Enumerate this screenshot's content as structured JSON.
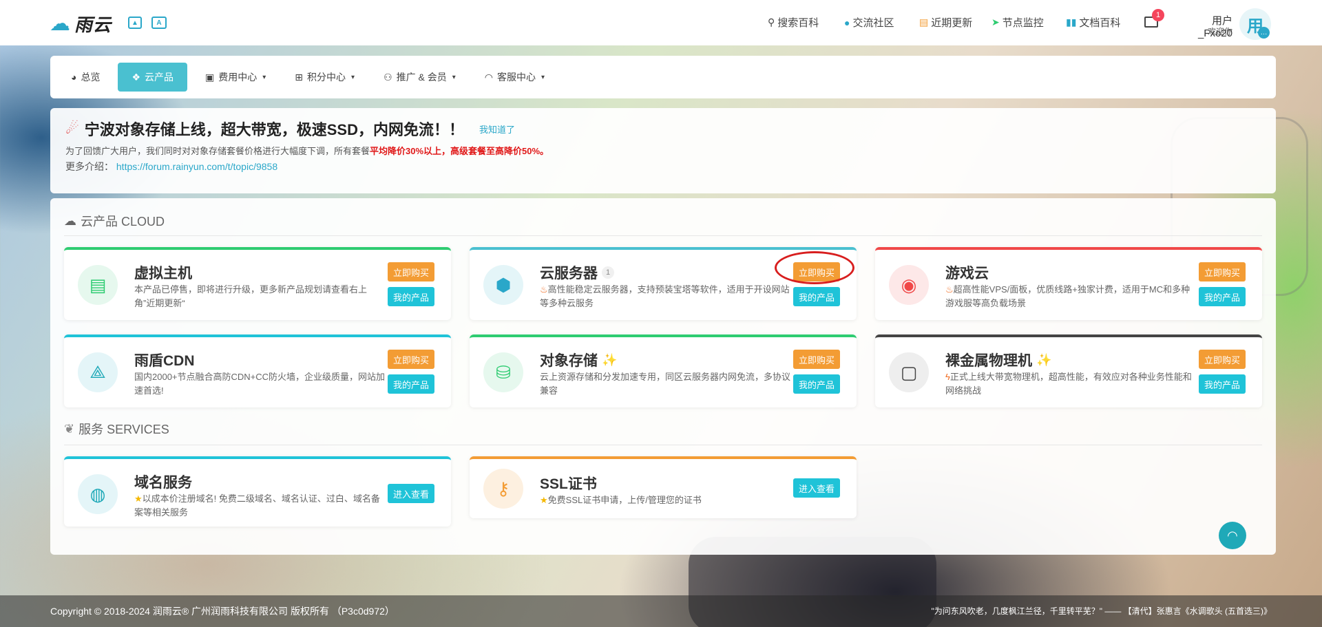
{
  "header": {
    "logo_text": "雨云",
    "icon1": "image-icon",
    "icon2": "translate-icon",
    "nav": [
      {
        "label": "搜索百科",
        "icon": "search-icon"
      },
      {
        "label": "交流社区",
        "icon": "chat-icon"
      },
      {
        "label": "近期更新",
        "icon": "list-icon"
      },
      {
        "label": "节点监控",
        "icon": "send-icon"
      },
      {
        "label": "文档百科",
        "icon": "book-icon"
      }
    ],
    "mail_badge": "1",
    "user_name": "用户_Fxo20",
    "user_welcome": "欢迎你",
    "avatar_text": "用"
  },
  "mainnav": [
    {
      "label": "总览",
      "icon": "dashboard-icon",
      "active": false,
      "dropdown": false
    },
    {
      "label": "云产品",
      "icon": "cloud-cubes-icon",
      "active": true,
      "dropdown": false
    },
    {
      "label": "费用中心",
      "icon": "money-icon",
      "active": false,
      "dropdown": true
    },
    {
      "label": "积分中心",
      "icon": "gift-icon",
      "active": false,
      "dropdown": true
    },
    {
      "label": "推广 & 会员",
      "icon": "users-icon",
      "active": false,
      "dropdown": true
    },
    {
      "label": "客服中心",
      "icon": "headset-icon",
      "active": false,
      "dropdown": true
    }
  ],
  "notice": {
    "title": "宁波对象存储上线，超大带宽，极速SSD，内网免流！！",
    "dismiss": "我知道了",
    "line_prefix": "为了回馈广大用户，我们同时对对象存储套餐价格进行大幅度下调，所有套餐",
    "line_highlight": "平均降价30%以上，高级套餐至高降价50%。",
    "more_label": "更多介绍：",
    "more_link": "https://forum.rainyun.com/t/topic/9858"
  },
  "cloud_section": {
    "title": "云产品 CLOUD",
    "cards": [
      {
        "name": "虚拟主机",
        "desc": "本产品已停售，即将进行升级，更多新产品规划请查看右上角”近期更新“",
        "buy": "立即购买",
        "my": "我的产品",
        "color": "#2ecc71",
        "icon": "server-icon",
        "badge": "",
        "desc_icon": ""
      },
      {
        "name": "云服务器",
        "desc": "高性能稳定云服务器，支持预装宝塔等软件，适用于开设网站等多种云服务",
        "buy": "立即购买",
        "my": "我的产品",
        "color": "#4ac0d0",
        "icon": "cube-icon",
        "badge": "1",
        "desc_icon": "fire"
      },
      {
        "name": "游戏云",
        "desc": "超高性能VPS/面板，优质线路+独家计费，适用于MC和多种游戏服等高负载场景",
        "buy": "立即购买",
        "my": "我的产品",
        "color": "#f04848",
        "icon": "gamepad-icon",
        "badge": "",
        "desc_icon": "fire"
      },
      {
        "name": "雨盾CDN",
        "desc": "国内2000+节点融合高防CDN+CC防火墙，企业级质量，网站加速首选!",
        "buy": "立即购买",
        "my": "我的产品",
        "color": "#1fc3d8",
        "icon": "share-node-icon",
        "badge": "",
        "desc_icon": ""
      },
      {
        "name": "对象存储",
        "desc": "云上资源存储和分发加速专用，同区云服务器内网免流，多协议兼容",
        "buy": "立即购买",
        "my": "我的产品",
        "color": "#2ecc71",
        "icon": "database-icon",
        "badge": "",
        "desc_icon": "",
        "party": true
      },
      {
        "name": "裸金属物理机",
        "desc": "正式上线大带宽物理机，超高性能，有效应对各种业务性能和网络挑战",
        "buy": "立即购买",
        "my": "我的产品",
        "color": "#444444",
        "icon": "square-nodes-icon",
        "badge": "",
        "desc_icon": "bolt",
        "party": true
      }
    ]
  },
  "services_section": {
    "title": "服务 SERVICES",
    "cards": [
      {
        "name": "域名服务",
        "desc": "以成本价注册域名! 免费二级域名、域名认证、过白、域名备案等相关服务",
        "action": "进入查看",
        "color": "#1fc3d8",
        "icon": "globe-icon"
      },
      {
        "name": "SSL证书",
        "desc": "免费SSL证书申请，上传/管理您的证书",
        "action": "进入查看",
        "color": "#f39c34",
        "icon": "key-icon"
      }
    ]
  },
  "footer": {
    "copyright": "Copyright © 2018-2024 润雨云® 广州润雨科技有限公司 版权所有 （P3c0d972）",
    "quote": "\"为问东风吹老，几度枫江兰径，千里转平芜？\" —— 【清代】张惠言《水调歌头 (五首选三)》"
  }
}
